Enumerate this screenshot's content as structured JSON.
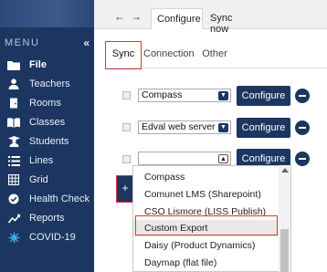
{
  "sidebar": {
    "menu_title": "MENU",
    "collapse_glyph": "«",
    "items": [
      {
        "label": "File",
        "icon": "folder-icon"
      },
      {
        "label": "Teachers",
        "icon": "person-icon"
      },
      {
        "label": "Rooms",
        "icon": "door-icon"
      },
      {
        "label": "Classes",
        "icon": "book-icon"
      },
      {
        "label": "Students",
        "icon": "student-icon"
      },
      {
        "label": "Lines",
        "icon": "lines-icon"
      },
      {
        "label": "Grid",
        "icon": "grid-icon"
      },
      {
        "label": "Health Check",
        "icon": "health-check-icon"
      },
      {
        "label": "Reports",
        "icon": "chart-icon"
      },
      {
        "label": "COVID-19",
        "icon": "virus-icon"
      }
    ]
  },
  "topbar": {
    "back_glyph": "←",
    "forward_glyph": "→",
    "tabs": [
      "Configure",
      "Sync now"
    ]
  },
  "subtabs": [
    "Sync",
    "Connection",
    "Other"
  ],
  "rows": [
    {
      "value": "Compass",
      "configure_label": "Configure"
    },
    {
      "value": "Edval web server",
      "configure_label": "Configure"
    },
    {
      "value": "",
      "configure_label": "Configure"
    }
  ],
  "add_button": {
    "label": "+"
  },
  "dropdown": {
    "options": [
      "Compass",
      "Comunet LMS (Sharepoint)",
      "CSO Lismore (LISS Publish)",
      "Custom Export",
      "Daisy (Product Dynamics)",
      "Daymap (flat file)"
    ],
    "highlighted": "Custom Export"
  },
  "colors": {
    "sidebar": "#1c3661",
    "accent": "#1c3661",
    "highlight_border": "#d43a3a"
  }
}
